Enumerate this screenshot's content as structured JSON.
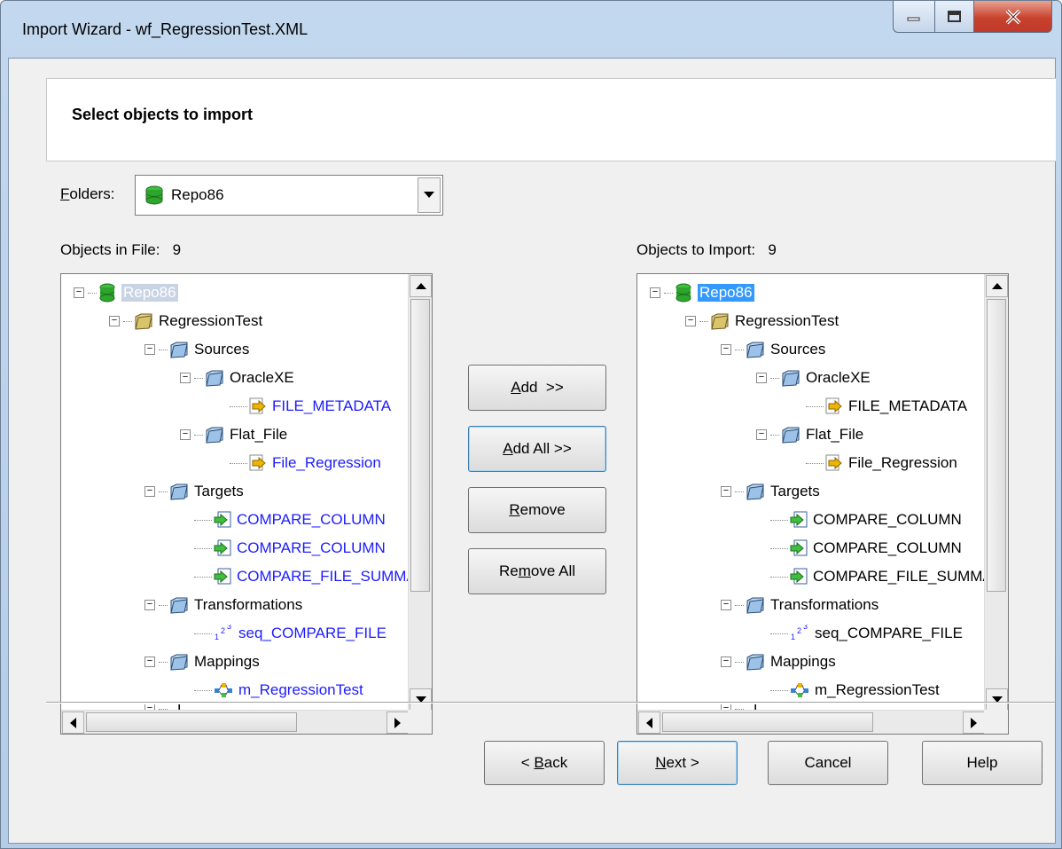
{
  "window": {
    "title": "Import Wizard - wf_RegressionTest.XML",
    "minimize_glyph": "▁",
    "maximize_glyph": "▫",
    "close_glyph": "X"
  },
  "header": {
    "title": "Select objects to import"
  },
  "folders": {
    "label_accel": "F",
    "label_rest": "olders:",
    "selected": "Repo86",
    "icon": "database-icon"
  },
  "left_panel": {
    "label": "Objects in File:",
    "count": "9"
  },
  "right_panel": {
    "label": "Objects to Import:",
    "count": "9"
  },
  "tree": {
    "root": "Repo86",
    "folder": "RegressionTest",
    "sources": "Sources",
    "oraclexe": "OracleXE",
    "file_metadata": "FILE_METADATA",
    "flat_file": "Flat_File",
    "file_regression": "File_Regression",
    "targets": "Targets",
    "compare_column_1": "COMPARE_COLUMN",
    "compare_column_2": "COMPARE_COLUMN",
    "compare_file": "COMPARE_FILE_SUMMARY",
    "transformations": "Transformations",
    "seq": "seq_COMPARE_FILE",
    "mappings": "Mappings",
    "mapping": "m_RegressionTest",
    "tasks_partial": "T..."
  },
  "transfer_buttons": {
    "add_accel": "A",
    "add_rest": "dd  >>",
    "add_all_accel": "A",
    "add_all_rest": "dd All >>",
    "remove_accel": "R",
    "remove_rest": "emove",
    "remove_all_pre": "Re",
    "remove_all_accel": "m",
    "remove_all_rest": "ove All"
  },
  "footer": {
    "back_pre": "< ",
    "back_accel": "B",
    "back_rest": "ack",
    "next_accel": "N",
    "next_rest": "ext >",
    "cancel": "Cancel",
    "help": "Help"
  },
  "colors": {
    "link_blue": "#1c1cff",
    "selection_blue": "#3399ff",
    "selection_gray": "#c8d4e4"
  }
}
